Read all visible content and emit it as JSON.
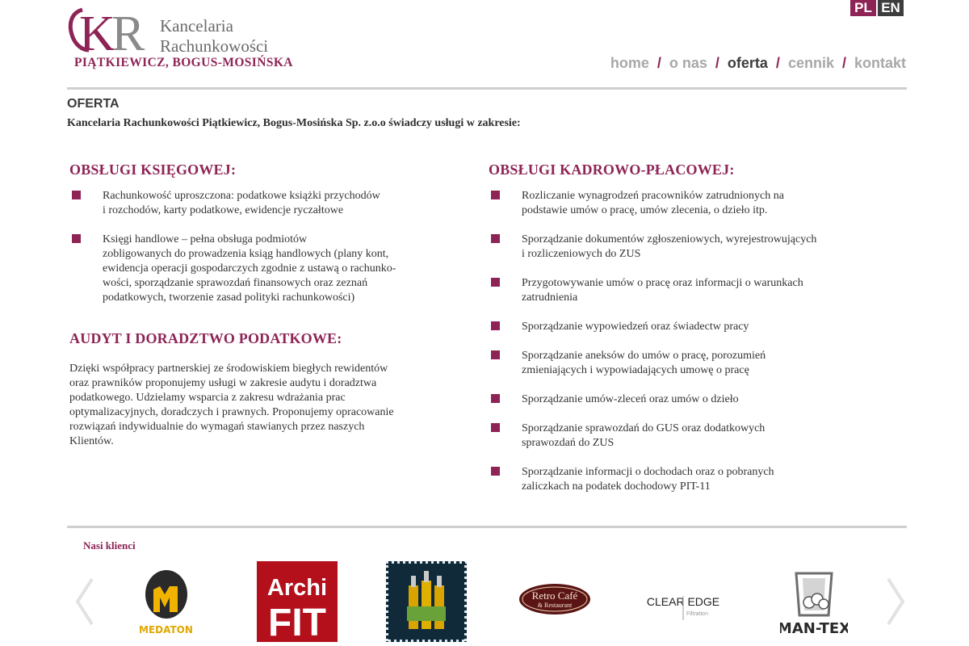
{
  "lang": {
    "pl": "PL",
    "en": "EN"
  },
  "logo": {
    "monogram": "KR",
    "name_line1": "Kancelaria",
    "name_line2": "Rachunkowości",
    "names": "PIĄTKIEWICZ, BOGUS-MOSIŃSKA"
  },
  "nav": {
    "items": [
      "home",
      "o nas",
      "oferta",
      "cennik",
      "kontakt"
    ],
    "separator": "/",
    "active": "oferta"
  },
  "page": {
    "title": "OFERTA",
    "intro": "Kancelaria Rachunkowości Piątkiewicz, Bogus-Mosińska Sp. z.o.o świadczy usługi w zakresie:"
  },
  "sections": {
    "accounting": {
      "title": "OBSŁUGI KSIĘGOWEJ:",
      "items": [
        [
          "Rachunkowość uproszczona: podatkowe książki przychodów",
          "i rozchodów, karty podatkowe, ewidencje ryczałtowe"
        ],
        [
          "Księgi handlowe – pełna obsługa podmiotów",
          "zobligowanych do prowadzenia ksiąg handlowych (plany kont,",
          "ewidencja operacji gospodarczych zgodnie z ustawą o rachunko-",
          "wości, sporządzanie sprawozdań finansowych oraz zeznań",
          "podatkowych, tworzenie zasad polityki rachunkowości)"
        ]
      ]
    },
    "audit": {
      "title": "AUDYT I DORADZTWO PODATKOWE:",
      "lines": [
        "Dzięki współpracy partnerskiej ze środowiskiem biegłych rewidentów",
        "oraz prawników proponujemy usługi w zakresie audytu i doradztwa",
        "podatkowego. Udzielamy wsparcia z zakresu wdrażania prac",
        "optymalizacyjnych, doradczych i prawnych. Proponujemy opracowanie",
        "rozwiązań indywidualnie do wymagań stawianych przez naszych",
        "Klientów."
      ]
    },
    "payroll": {
      "title": "OBSŁUGI KADROWO-PŁACOWEJ:",
      "items": [
        [
          "Rozliczanie wynagrodzeń pracowników zatrudnionych na",
          "podstawie umów o pracę, umów zlecenia, o dzieło itp."
        ],
        [
          "Sporządzanie dokumentów zgłoszeniowych, wyrejestrowujących",
          "i rozliczeniowych do ZUS"
        ],
        [
          "Przygotowywanie umów o pracę oraz informacji o warunkach",
          "zatrudnienia"
        ],
        [
          "Sporządzanie wypowiedzeń oraz świadectw pracy"
        ],
        [
          "Sporządzanie aneksów do umów o pracę, porozumień",
          "zmieniających i wypowiadających umowę o pracę"
        ],
        [
          "Sporządzanie umów-zleceń oraz umów o dzieło"
        ],
        [
          "Sporządzanie sprawozdań do GUS oraz dodatkowych",
          "sprawozdań do ZUS"
        ],
        [
          "Sporządzanie informacji o dochodach oraz o pobranych",
          "zaliczkach na podatek dochodowy PIT-11"
        ]
      ]
    }
  },
  "clients": {
    "title": "Nasi klienci",
    "logos": [
      {
        "name": "medaton",
        "text": "MEDATON"
      },
      {
        "name": "archifit",
        "line1": "Archi",
        "line2": "FIT"
      },
      {
        "name": "bottles"
      },
      {
        "name": "retro-cafe",
        "line1": "Retro Café",
        "line2": "& Restaurant"
      },
      {
        "name": "clearedge",
        "line1": "CLEAR EDGE",
        "line2": "Filtration"
      },
      {
        "name": "man-tex",
        "text": "MAN-TEX"
      }
    ]
  },
  "colors": {
    "accent": "#8e2456",
    "nav_inactive": "#a8a8a8",
    "nav_active": "#3d3d3d",
    "rule": "#cfcfcf"
  }
}
